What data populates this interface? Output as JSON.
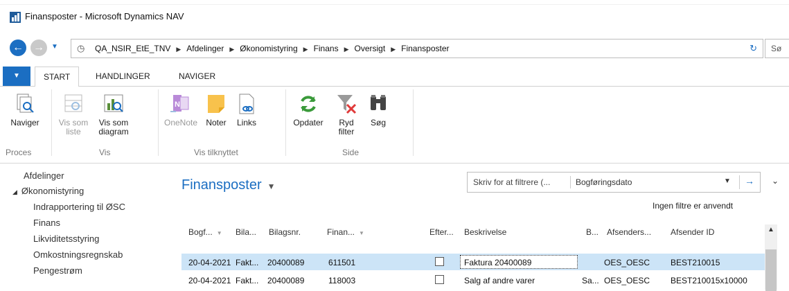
{
  "window": {
    "title": "Finansposter - Microsoft Dynamics NAV"
  },
  "address": {
    "crumbs": [
      "QA_NSIR_EtE_TNV",
      "Afdelinger",
      "Økonomistyring",
      "Finans",
      "Oversigt",
      "Finansposter"
    ],
    "search_placeholder": "Sø"
  },
  "tabs": [
    {
      "label": "START",
      "active": true
    },
    {
      "label": "HANDLINGER",
      "active": false
    },
    {
      "label": "NAVIGER",
      "active": false
    }
  ],
  "ribbon": {
    "naviger": "Naviger",
    "vis_som_liste_1": "Vis som",
    "vis_som_liste_2": "liste",
    "vis_som_diagram_1": "Vis som",
    "vis_som_diagram_2": "diagram",
    "onenote": "OneNote",
    "noter": "Noter",
    "links": "Links",
    "opdater": "Opdater",
    "ryd_filter_1": "Ryd",
    "ryd_filter_2": "filter",
    "sog": "Søg",
    "groups": {
      "proces": "Proces",
      "vis": "Vis",
      "vis_tilknyttet": "Vis tilknyttet",
      "side": "Side"
    }
  },
  "sidebar": {
    "items": [
      "Afdelinger",
      "Økonomistyring",
      "Indrapportering til ØSC",
      "Finans",
      "Likviditetsstyring",
      "Omkostningsregnskab",
      "Pengestrøm"
    ],
    "expand_glyph": "◢"
  },
  "main": {
    "title": "Finansposter",
    "filter_placeholder": "Skriv for at filtrere (...",
    "filter_field": "Bogføringsdato",
    "no_filters": "Ingen filtre er anvendt"
  },
  "grid": {
    "headers": [
      "Bogf...",
      "Bila...",
      "Bilagsnr.",
      "Finan...",
      "Efter...",
      "Beskrivelse",
      "B...",
      "Afsenders...",
      "Afsender ID"
    ],
    "rows": [
      {
        "date": "20-04-2021",
        "type": "Fakt...",
        "doc": "20400089",
        "account": "611501",
        "checked": false,
        "desc": "Faktura 20400089",
        "b": "",
        "sender": "OES_OESC",
        "sender_id": "BEST210015",
        "selected": true
      },
      {
        "date": "20-04-2021",
        "type": "Fakt...",
        "doc": "20400089",
        "account": "118003",
        "checked": false,
        "desc": "Salg af andre varer",
        "b": "Sa...",
        "sender": "OES_OESC",
        "sender_id": "BEST210015x10000",
        "selected": false
      }
    ]
  },
  "colors": {
    "accent": "#1b6ec2",
    "selected_row": "#cce4f7"
  }
}
